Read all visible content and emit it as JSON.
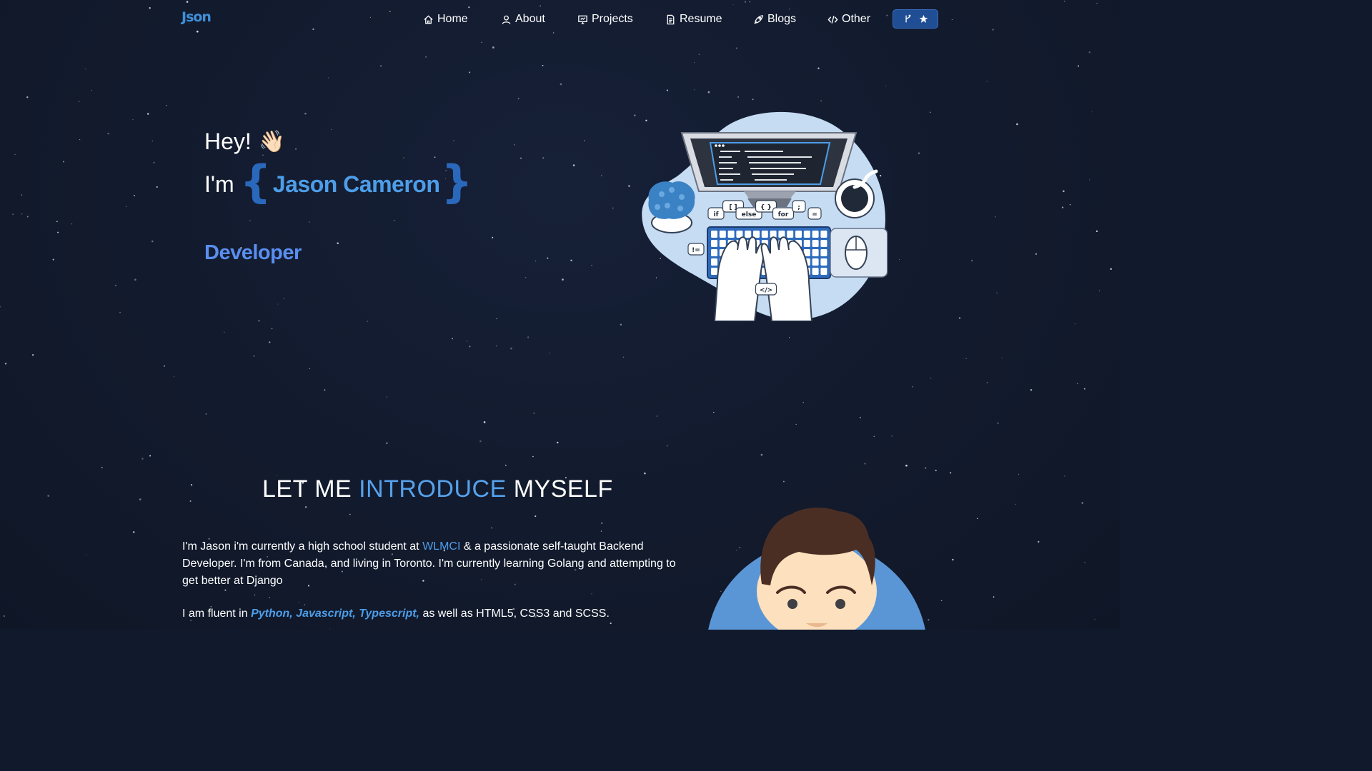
{
  "navbar": {
    "logo": "Json",
    "items": [
      {
        "label": "Home",
        "icon": "home-icon"
      },
      {
        "label": "About",
        "icon": "user-icon"
      },
      {
        "label": "Projects",
        "icon": "presentation-icon"
      },
      {
        "label": "Resume",
        "icon": "document-icon"
      },
      {
        "label": "Blogs",
        "icon": "rocket-icon"
      },
      {
        "label": "Other",
        "icon": "code-icon"
      }
    ],
    "fork_button": {
      "icons": [
        "git-fork-icon",
        "star-icon"
      ]
    }
  },
  "hero": {
    "greeting": "Hey!",
    "greeting_emoji": "👋🏻",
    "intro_prefix": "I'm",
    "brace_open": "{",
    "name": "Jason Cameron",
    "brace_close": "}",
    "role": "Developer",
    "illustration": "developer-typing-illustration",
    "code_bubbles": [
      "if",
      "[ ]",
      "else",
      "{ }",
      "for",
      ";",
      "=",
      "!=",
      "</>"
    ]
  },
  "intro": {
    "title_part1": "LET ME",
    "title_accent": "INTRODUCE",
    "title_part2": "MYSELF",
    "p1_before": "I'm Jason i'm currently a high school student at",
    "p1_link": "WLMCI",
    "p1_after": "& a passionate self-taught Backend Developer. I'm from Canada, and living in Toronto. I'm currently learning Golang and attempting to get better at Django",
    "p2_before": "I am fluent in",
    "p2_langs": "Python, Javascript, Typescript,",
    "p2_after": "as well as HTML5, CSS3 and SCSS.",
    "avatar": "avatar-illustration"
  },
  "colors": {
    "background": "#121a2d",
    "accent": "#4d9de8",
    "role": "#5a8ef0",
    "brace": "#2a68bb",
    "fork_button": "#1f4e94"
  }
}
